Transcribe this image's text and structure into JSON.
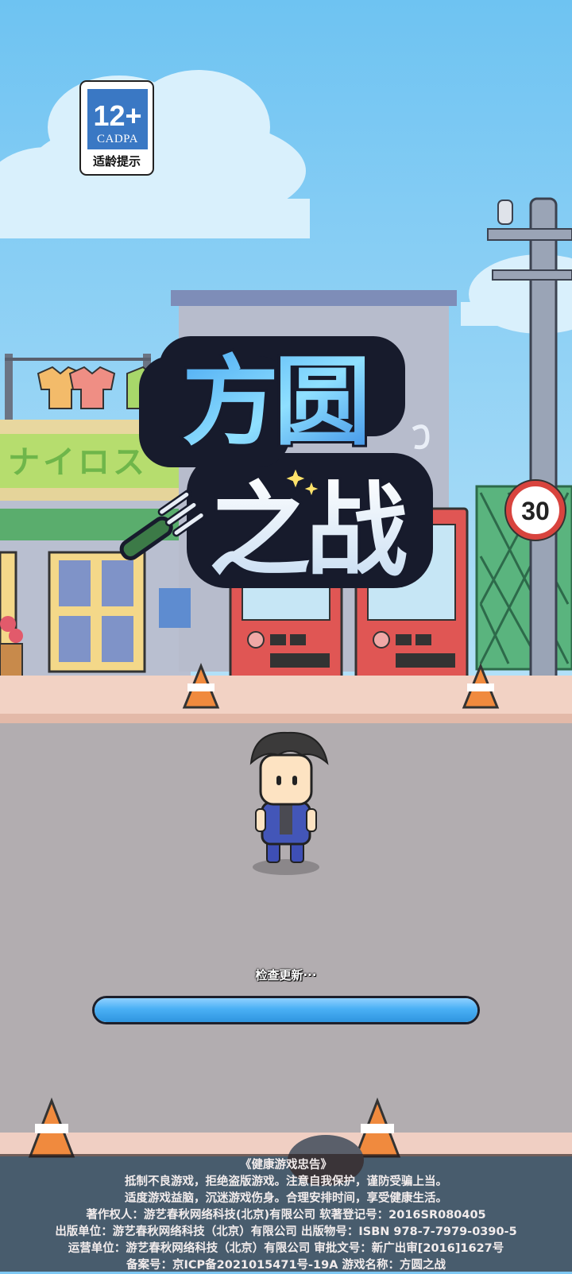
{
  "rating": {
    "age": "12+",
    "org": "CADPA",
    "hint": "适龄提示"
  },
  "game": {
    "logo_line1": "方圆",
    "logo_line2": "之战"
  },
  "scene": {
    "speed_limit": "30",
    "shop_sign": "ナイロス"
  },
  "loading": {
    "status_text": "检查更新···",
    "progress": 1.0
  },
  "notice": {
    "title": "《健康游戏忠告》",
    "line1": "抵制不良游戏，拒绝盗版游戏。注意自我保护，谨防受骗上当。",
    "line2": "适度游戏益脑，沉迷游戏伤身。合理安排时间，享受健康生活。",
    "line3": "著作权人：游艺春秋网络科技(北京)有限公司 软著登记号：2016SR080405",
    "line4": "出版单位：游艺春秋网络科技（北京）有限公司 出版物号：ISBN 978-7-7979-0390-5",
    "line5": "运营单位：游艺春秋网络科技（北京）有限公司 审批文号：新广出审[2016]1627号",
    "line6": "备案号：京ICP备2021015471号-19A 游戏名称：方圆之战"
  }
}
